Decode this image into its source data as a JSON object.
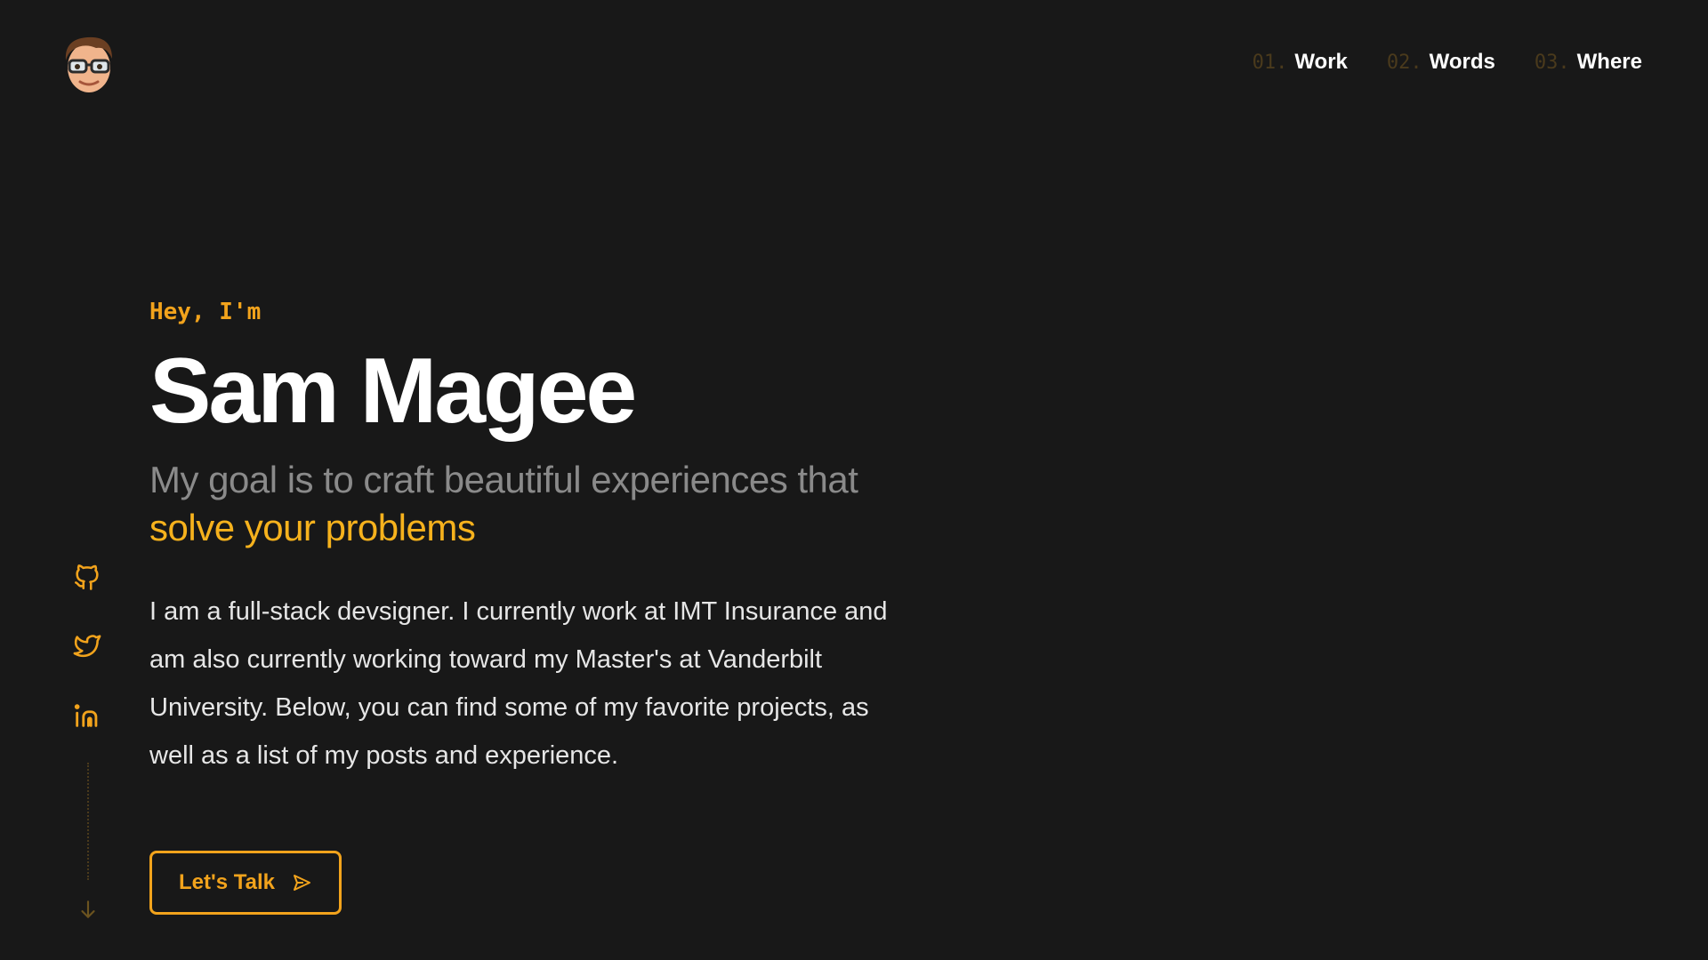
{
  "header": {
    "avatar_alt": "avatar",
    "nav": [
      {
        "num": "01.",
        "label": "Work"
      },
      {
        "num": "02.",
        "label": "Words"
      },
      {
        "num": "03.",
        "label": "Where"
      }
    ]
  },
  "social": [
    {
      "icon": "github-icon"
    },
    {
      "icon": "twitter-icon"
    },
    {
      "icon": "linkedin-icon"
    }
  ],
  "hero": {
    "greeting": "Hey, I'm",
    "name": "Sam Magee",
    "tagline": "My goal is to craft beautiful experiences that",
    "tagline_highlight": "solve your problems",
    "bio": "I am a full-stack devsigner. I currently work at IMT Insurance and am also currently working toward my Master's at Vanderbilt University. Below, you can find some of my favorite projects, as well as a list of my posts and experience.",
    "cta_label": "Let's Talk"
  },
  "colors": {
    "background": "#181818",
    "accent": "#f2a31c",
    "highlight": "#f6b21d",
    "muted": "#8a8a8a",
    "nav_number": "#4a3a1c"
  }
}
